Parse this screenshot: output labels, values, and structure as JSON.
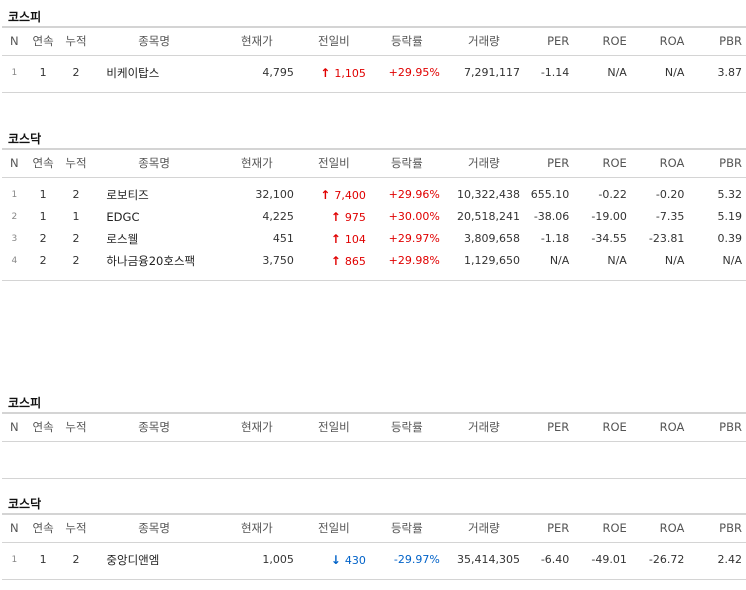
{
  "columns": [
    "N",
    "연속",
    "누적",
    "종목명",
    "현재가",
    "전일비",
    "등락률",
    "거래량",
    "PER",
    "ROE",
    "ROA",
    "PBR"
  ],
  "sections": [
    {
      "title": "코스피",
      "rows": [
        {
          "n": "1",
          "streak": "1",
          "total": "2",
          "name": "비케이탑스",
          "price": "4,795",
          "dir": "up",
          "change": "1,105",
          "rate": "+29.95%",
          "volume": "7,291,117",
          "per": "-1.14",
          "roe": "N/A",
          "roa": "N/A",
          "pbr": "3.87"
        }
      ]
    },
    {
      "title": "코스닥",
      "rows": [
        {
          "n": "1",
          "streak": "1",
          "total": "2",
          "name": "로보티즈",
          "price": "32,100",
          "dir": "up",
          "change": "7,400",
          "rate": "+29.96%",
          "volume": "10,322,438",
          "per": "655.10",
          "roe": "-0.22",
          "roa": "-0.20",
          "pbr": "5.32"
        },
        {
          "n": "2",
          "streak": "1",
          "total": "1",
          "name": "EDGC",
          "price": "4,225",
          "dir": "up",
          "change": "975",
          "rate": "+30.00%",
          "volume": "20,518,241",
          "per": "-38.06",
          "roe": "-19.00",
          "roa": "-7.35",
          "pbr": "5.19"
        },
        {
          "n": "3",
          "streak": "2",
          "total": "2",
          "name": "로스웰",
          "price": "451",
          "dir": "up",
          "change": "104",
          "rate": "+29.97%",
          "volume": "3,809,658",
          "per": "-1.18",
          "roe": "-34.55",
          "roa": "-23.81",
          "pbr": "0.39"
        },
        {
          "n": "4",
          "streak": "2",
          "total": "2",
          "name": "하나금융20호스팩",
          "price": "3,750",
          "dir": "up",
          "change": "865",
          "rate": "+29.98%",
          "volume": "1,129,650",
          "per": "N/A",
          "roe": "N/A",
          "roa": "N/A",
          "pbr": "N/A"
        }
      ]
    },
    {
      "title": "코스피",
      "rows": []
    },
    {
      "title": "코스닥",
      "rows": [
        {
          "n": "1",
          "streak": "1",
          "total": "2",
          "name": "중앙디앤엠",
          "price": "1,005",
          "dir": "down",
          "change": "430",
          "rate": "-29.97%",
          "volume": "35,414,305",
          "per": "-6.40",
          "roe": "-49.01",
          "roa": "-26.72",
          "pbr": "2.42"
        }
      ]
    }
  ]
}
